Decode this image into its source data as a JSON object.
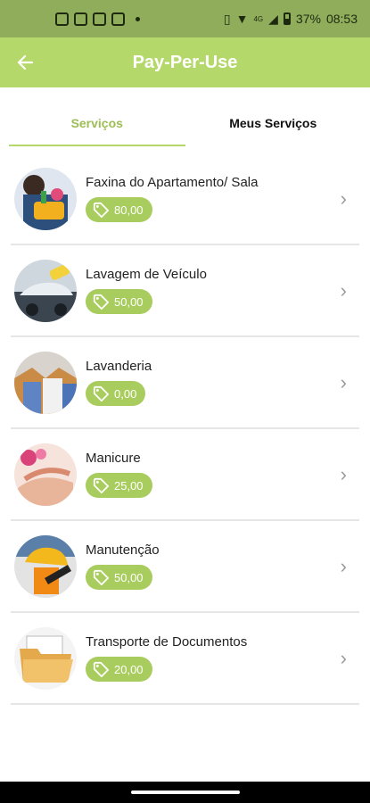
{
  "status": {
    "battery": "37%",
    "time": "08:53",
    "network": "4G"
  },
  "header": {
    "title": "Pay-Per-Use",
    "back_icon": "arrow-back-icon"
  },
  "tabs": [
    {
      "label": "Serviços",
      "active": true
    },
    {
      "label": "Meus Serviços",
      "active": false
    }
  ],
  "services": [
    {
      "name": "Faxina do Apartamento/ Sala",
      "price": "80,00",
      "image": "cleaning-image"
    },
    {
      "name": "Lavagem de Veículo",
      "price": "50,00",
      "image": "car-wash-image"
    },
    {
      "name": "Lavanderia",
      "price": "0,00",
      "image": "laundry-image"
    },
    {
      "name": "Manicure",
      "price": "25,00",
      "image": "manicure-image"
    },
    {
      "name": "Manutenção",
      "price": "50,00",
      "image": "maintenance-image"
    },
    {
      "name": "Transporte de Documentos",
      "price": "20,00",
      "image": "folder-image"
    }
  ],
  "colors": {
    "status_bar": "#8fad5a",
    "app_bar": "#b5d86b",
    "price_badge": "#a8cc5e",
    "tab_active": "#9dbd55"
  }
}
